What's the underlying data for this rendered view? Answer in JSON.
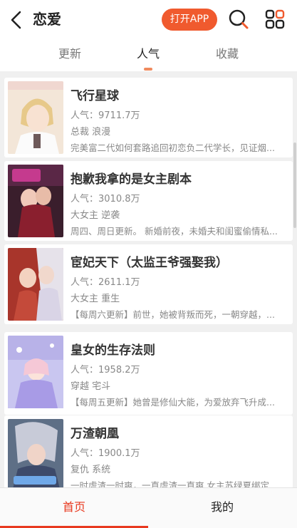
{
  "header": {
    "title": "恋爱",
    "open_app_label": "打开APP"
  },
  "tabs": [
    {
      "label": "更新"
    },
    {
      "label": "人气"
    },
    {
      "label": "收藏"
    }
  ],
  "comics": [
    {
      "title": "飞行星球",
      "popularity": "人气：9711.7万",
      "tags": "总裁 浪漫",
      "desc": "完美富二代如何套路追回初恋负二代学长，见证烟..."
    },
    {
      "title": "抱歉我拿的是女主剧本",
      "popularity": "人气：3010.8万",
      "tags": "大女主 逆袭",
      "desc": "周四、周日更新。 新婚前夜，未婚夫和闺蜜偷情私..."
    },
    {
      "title": "宦妃天下（太监王爷强娶我）",
      "popularity": "人气：2611.1万",
      "tags": "大女主 重生",
      "desc": "【每周六更新】前世，她被背叛而死，一朝穿越，..."
    },
    {
      "title": "皇女的生存法则",
      "popularity": "人气：1958.2万",
      "tags": "穿越 宅斗",
      "desc": "【每周五更新】她曾是修仙大能，为爱放弃飞升成..."
    },
    {
      "title": "万渣朝凰",
      "popularity": "人气：1900.1万",
      "tags": "复仇 系统",
      "desc": "一时虐渣一时爽，一直虐渣一直爽 女主苏绿夏绑定..."
    }
  ],
  "bottom_nav": [
    {
      "label": "首页"
    },
    {
      "label": "我的"
    }
  ],
  "colors": {
    "accent": "#f05a2e",
    "active_nav": "#e8391f"
  }
}
